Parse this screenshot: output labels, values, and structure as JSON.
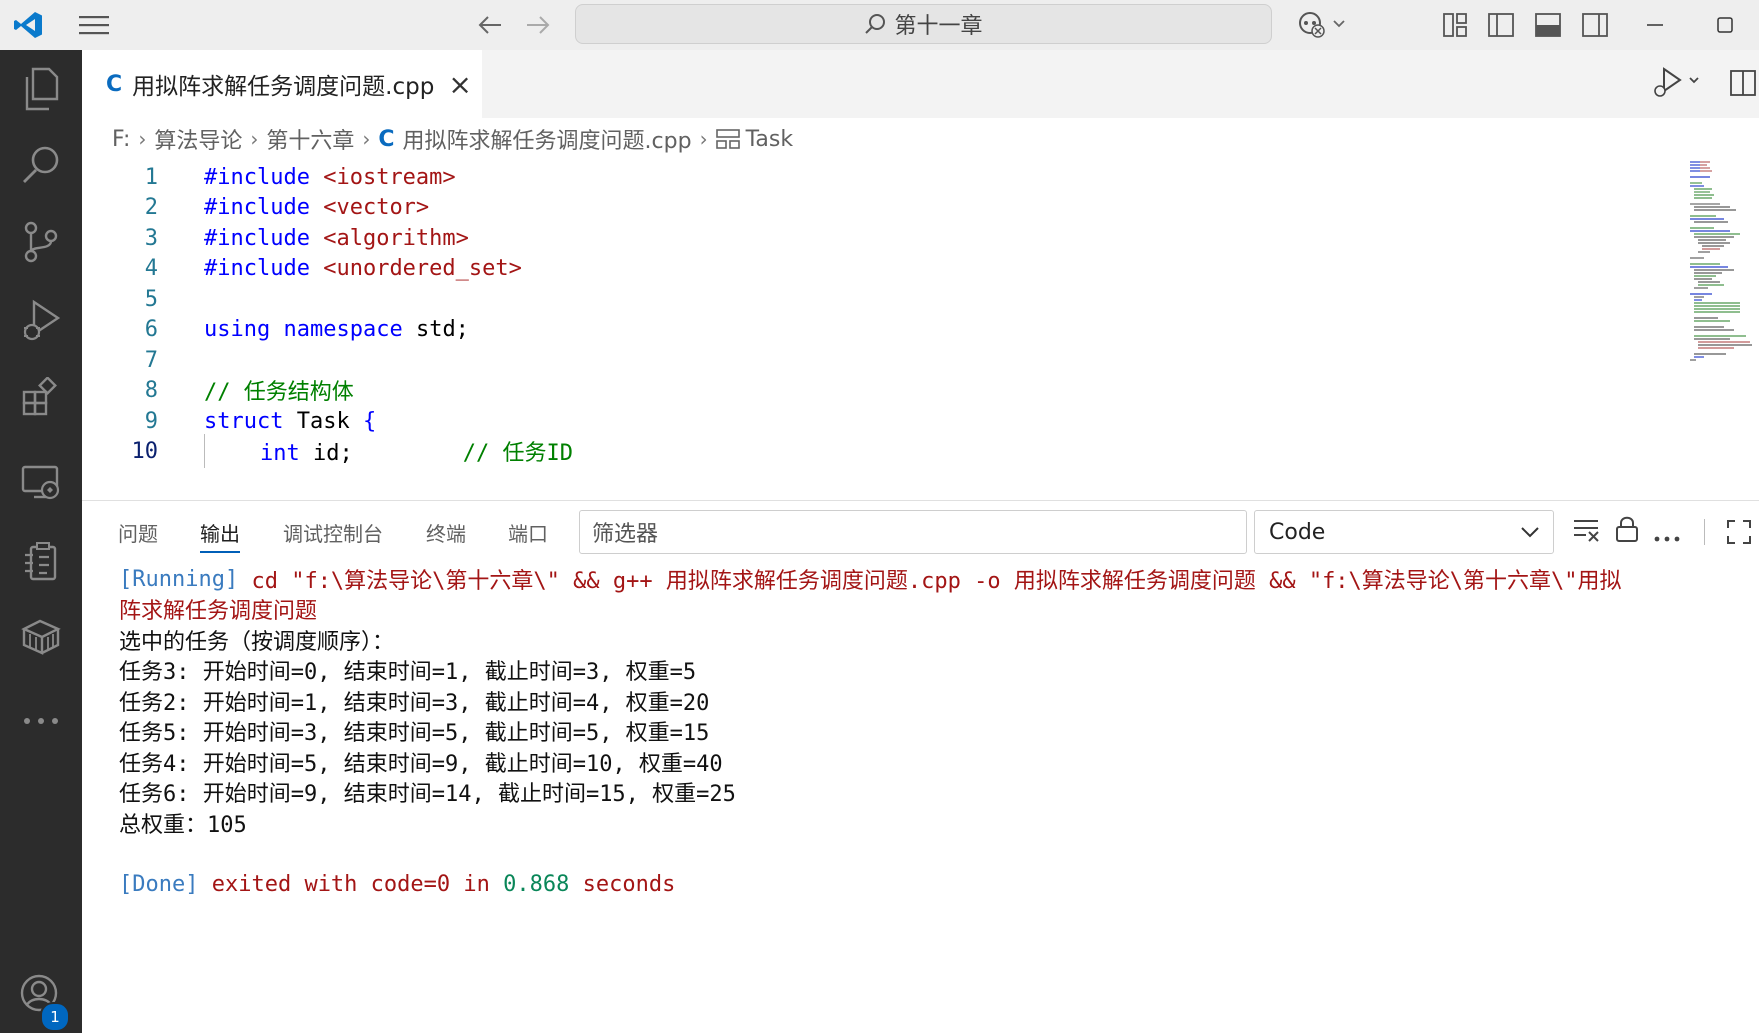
{
  "window": {
    "search_text": "第十一章"
  },
  "tab": {
    "title": "用拟阵求解任务调度问题.cpp",
    "close": "×"
  },
  "breadcrumb": {
    "drive": "F:",
    "folder1": "算法导论",
    "folder2": "第十六章",
    "file": "用拟阵求解任务调度问题.cpp",
    "symbol": "Task"
  },
  "editor": {
    "lines": [
      {
        "n": "1",
        "kw": "#include",
        "rest": " <iostream>"
      },
      {
        "n": "2",
        "kw": "#include",
        "rest": " <vector>"
      },
      {
        "n": "3",
        "kw": "#include",
        "rest": " <algorithm>"
      },
      {
        "n": "4",
        "kw": "#include",
        "rest": " <unordered_set>"
      },
      {
        "n": "5"
      },
      {
        "n": "6",
        "kw1": "using",
        "kw2": "namespace",
        "rest": " std;"
      },
      {
        "n": "7"
      },
      {
        "n": "8",
        "comment": "// 任务结构体"
      },
      {
        "n": "9",
        "kw": "struct",
        "name": " Task",
        "brace": " {"
      },
      {
        "n": "10",
        "kw": "int",
        "rest": " id;",
        "comment": "// 任务ID"
      }
    ]
  },
  "panel": {
    "tabs": [
      "问题",
      "输出",
      "调试控制台",
      "终端",
      "端口"
    ],
    "active_tab": "输出",
    "filter_placeholder": "筛选器",
    "channel": "Code"
  },
  "output": {
    "running_tag": "[Running]",
    "running_cmd": " cd \"f:\\算法导论\\第十六章\\\" && g++ 用拟阵求解任务调度问题.cpp -o 用拟阵求解任务调度问题 && \"f:\\算法导论\\第十六章\\\"用拟",
    "running_cmd_wrap": "阵求解任务调度问题",
    "lines": [
      "选中的任务（按调度顺序）：",
      "任务3: 开始时间=0, 结束时间=1, 截止时间=3, 权重=5",
      "任务2: 开始时间=1, 结束时间=3, 截止时间=4, 权重=20",
      "任务5: 开始时间=3, 结束时间=5, 截止时间=5, 权重=15",
      "任务4: 开始时间=5, 结束时间=9, 截止时间=10, 权重=40",
      "任务6: 开始时间=9, 结束时间=14, 截止时间=15, 权重=25",
      "总权重：105"
    ],
    "done_tag": "[Done]",
    "done_text1": " exited with ",
    "done_code": "code=0",
    "done_text2": " in ",
    "done_time": "0.868",
    "done_text3": " seconds"
  },
  "accounts_badge": "1",
  "colors": {
    "activity_bar": "#2c2c2c",
    "keyword": "#0000ff",
    "comment": "#008000",
    "string": "#a31515",
    "accent": "#005fb8"
  }
}
